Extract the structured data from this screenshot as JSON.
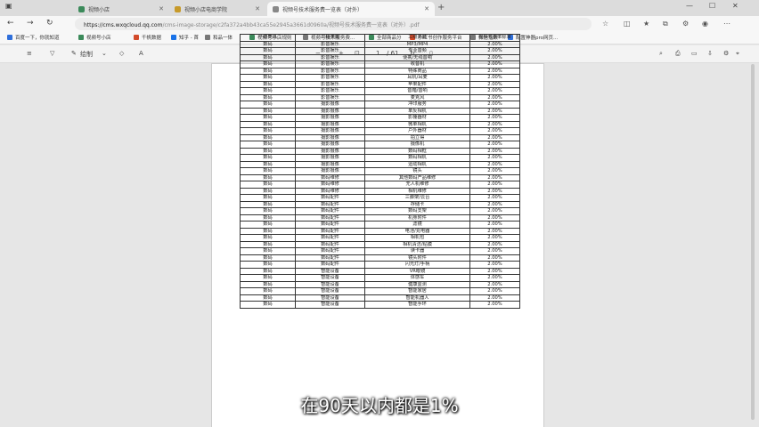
{
  "tabs": [
    {
      "label": "视频小店",
      "active": false
    },
    {
      "label": "视频小店电商学院",
      "active": false
    },
    {
      "label": "视频号技术服务费一览表（对外）",
      "active": true
    }
  ],
  "address": {
    "host": "https://cms.wxqcloud.qq.com",
    "path": "/cms-image-storage/c2fa372a4bb43ca55e2945a3661d0960a/视频号技术服务费一览表（对外）.pdf"
  },
  "bookmarks": [
    "百度一下，你就知道",
    "视频号小店",
    "千帆数据",
    "知乎 - 首",
    "和品一体",
    "视频号小店规则",
    "视频号技术服务费...",
    "全部商品分",
    "小红书创作服务平台",
    "微信指数",
    "配置神器pro网页..."
  ],
  "pdf_toolbar": {
    "draw_label": "绘制",
    "page_current": "1",
    "page_total": "/ 61",
    "zoom_out": "−",
    "zoom_in": "+"
  },
  "table": {
    "headers": [
      "一级类目",
      "二级类目",
      "三级类目",
      "视频号费率标准"
    ],
    "rows": [
      [
        "数码",
        "影音娱乐",
        "MP3/MP4",
        "2.00%"
      ],
      [
        "数码",
        "影音娱乐",
        "专业音频",
        "2.00%"
      ],
      [
        "数码",
        "影音娱乐",
        "便携/无线音响",
        "2.00%"
      ],
      [
        "数码",
        "影音娱乐",
        "收音机",
        "2.00%"
      ],
      [
        "数码",
        "影音娱乐",
        "特殊商品",
        "2.00%"
      ],
      [
        "数码",
        "影音娱乐",
        "耳机/耳麦",
        "2.00%"
      ],
      [
        "数码",
        "影音娱乐",
        "苹果配件",
        "2.00%"
      ],
      [
        "数码",
        "影音娱乐",
        "音箱/音响",
        "2.00%"
      ],
      [
        "数码",
        "影音娱乐",
        "麦克风",
        "2.00%"
      ],
      [
        "数码",
        "摄影摄像",
        "冲印服务",
        "2.00%"
      ],
      [
        "数码",
        "摄影摄像",
        "单反相机",
        "2.00%"
      ],
      [
        "数码",
        "摄影摄像",
        "影棚器材",
        "2.00%"
      ],
      [
        "数码",
        "摄影摄像",
        "微单相机",
        "2.00%"
      ],
      [
        "数码",
        "摄影摄像",
        "户外器材",
        "2.00%"
      ],
      [
        "数码",
        "摄影摄像",
        "拍立得",
        "2.00%"
      ],
      [
        "数码",
        "摄影摄像",
        "摄像机",
        "2.00%"
      ],
      [
        "数码",
        "摄影摄像",
        "数码相框",
        "2.00%"
      ],
      [
        "数码",
        "摄影摄像",
        "数码相机",
        "2.00%"
      ],
      [
        "数码",
        "摄影摄像",
        "运动相机",
        "2.00%"
      ],
      [
        "数码",
        "摄影摄像",
        "镜头",
        "2.00%"
      ],
      [
        "数码",
        "数码维修",
        "其他数码产品维修",
        "2.00%"
      ],
      [
        "数码",
        "数码维修",
        "无人机维修",
        "2.00%"
      ],
      [
        "数码",
        "数码维修",
        "相机维修",
        "2.00%"
      ],
      [
        "数码",
        "数码配件",
        "三脚架/云台",
        "2.00%"
      ],
      [
        "数码",
        "数码配件",
        "存储卡",
        "2.00%"
      ],
      [
        "数码",
        "数码配件",
        "数码支架",
        "2.00%"
      ],
      [
        "数码",
        "数码配件",
        "机身附件",
        "2.00%"
      ],
      [
        "数码",
        "数码配件",
        "滤镜",
        "2.00%"
      ],
      [
        "数码",
        "数码配件",
        "电池/充电器",
        "2.00%"
      ],
      [
        "数码",
        "数码配件",
        "相机包",
        "2.00%"
      ],
      [
        "数码",
        "数码配件",
        "相机清洁/贴膜",
        "2.00%"
      ],
      [
        "数码",
        "数码配件",
        "读卡器",
        "2.00%"
      ],
      [
        "数码",
        "数码配件",
        "镜头附件",
        "2.00%"
      ],
      [
        "数码",
        "数码配件",
        "闪光灯/手柄",
        "2.00%"
      ],
      [
        "数码",
        "智能设备",
        "VR眼镜",
        "2.00%"
      ],
      [
        "数码",
        "智能设备",
        "体感车",
        "2.00%"
      ],
      [
        "数码",
        "智能设备",
        "健康监测",
        "2.00%"
      ],
      [
        "数码",
        "智能设备",
        "智能家居",
        "2.00%"
      ],
      [
        "数码",
        "智能设备",
        "智能机器人",
        "2.00%"
      ],
      [
        "数码",
        "智能设备",
        "智能手环",
        "2.00%"
      ]
    ]
  },
  "subtitle": "在90天以内都是1%",
  "colors": {
    "tabbar": "#dcdcdc",
    "toolbar": "#f7f7f7",
    "viewer_bg": "#e6e6e6"
  }
}
